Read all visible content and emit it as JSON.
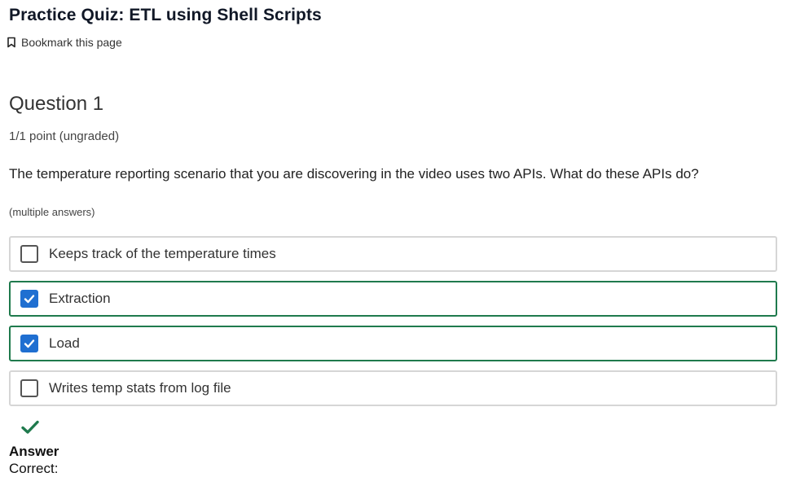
{
  "page": {
    "title": "Practice Quiz: ETL using Shell Scripts",
    "bookmark_label": "Bookmark this page",
    "bookmark_icon": "bookmark-icon"
  },
  "question": {
    "title": "Question 1",
    "points": "1/1 point (ungraded)",
    "prompt": "The temperature reporting scenario that you are discovering in the video uses two APIs. What do these APIs do?",
    "hint": "(multiple answers)",
    "options": [
      {
        "label": "Keeps track of the temperature times",
        "checked": false
      },
      {
        "label": "Extraction",
        "checked": true
      },
      {
        "label": "Load",
        "checked": true
      },
      {
        "label": "Writes temp stats from log file",
        "checked": false
      }
    ]
  },
  "result": {
    "icon": "checkmark-icon",
    "answer_heading": "Answer",
    "status": "Correct:",
    "correct_color": "#1f7a4d"
  },
  "colors": {
    "selected_border": "#1f7a4d",
    "checkbox_checked": "#1f6fd1",
    "border": "#d6d6d6"
  }
}
